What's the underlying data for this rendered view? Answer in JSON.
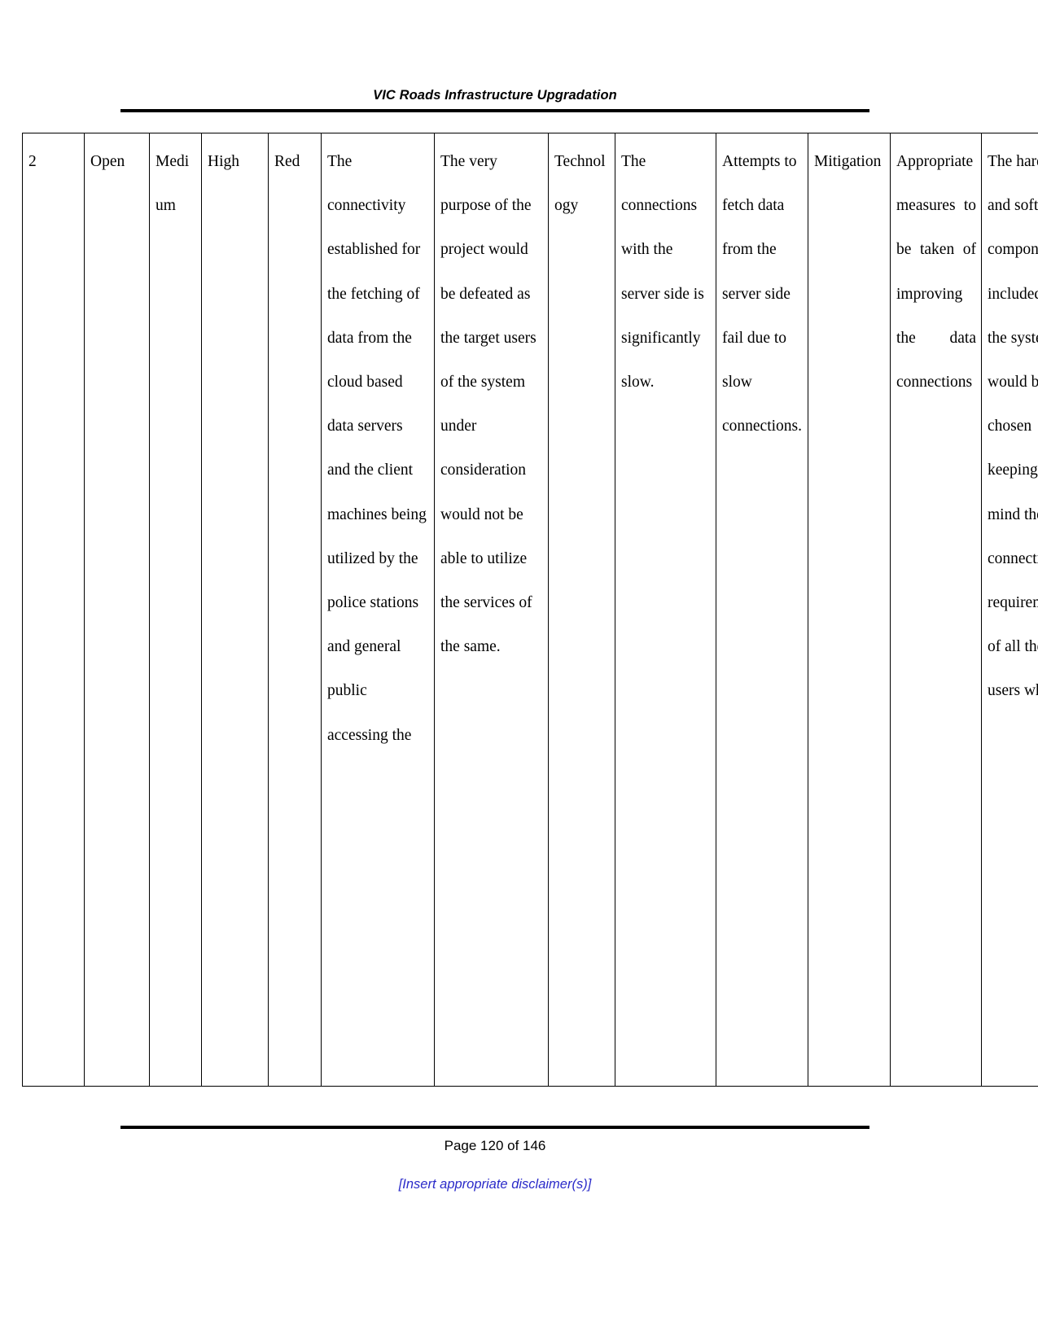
{
  "document": {
    "header_title": "VIC Roads Infrastructure Upgradation",
    "footer_page_label": "Page 120 of 146",
    "footer_disclaimer": "[Insert appropriate disclaimer(s)]",
    "disclaimer_color": "#2b2bc9",
    "rule_color": "#000000",
    "page_number": 120,
    "page_total": 146
  },
  "table": {
    "row": {
      "id": "2",
      "status": "Open",
      "likelihood": "Medium",
      "impact": "High",
      "rating": "Red",
      "risk_description": "The connectivity established for the fetching of data from the cloud based data servers and the client machines being utilized by the police stations and general public accessing the",
      "consequence": "The very purpose of the project would be defeated as the target users of the system under consideration would not be able to utilize the services of the same.",
      "category": "Technology",
      "cause": "The connections with the server side is significantly slow.",
      "effect": "Attempts to fetch data from the server side fail due to slow connections.",
      "response": "Mitigation",
      "action": "Appropriate measures to be taken of improving the data connections",
      "owner_notes": "The hardware and software components included in the system would be chosen keeping in mind the connectivity requirements of all the users who"
    }
  }
}
